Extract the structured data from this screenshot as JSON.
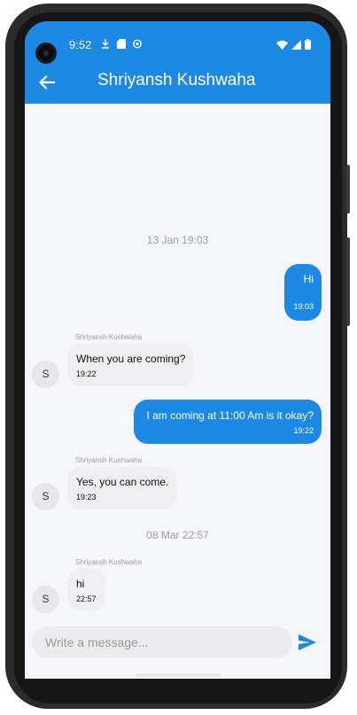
{
  "status_bar": {
    "time": "9:52"
  },
  "header": {
    "title": "Shriyansh Kushwaha"
  },
  "messages": [
    {
      "kind": "date",
      "text": "13 Jan 19:03"
    },
    {
      "kind": "out",
      "text": "Hi",
      "time": "19:03"
    },
    {
      "kind": "in",
      "sender": "Shriyansh Kushwaha",
      "avatar": "S",
      "text": "When you are coming?",
      "time": "19:22"
    },
    {
      "kind": "out",
      "text": "I am coming at 11:00 Am is it okay?",
      "time": "19:22"
    },
    {
      "kind": "in",
      "sender": "Shriyansh Kushwaha",
      "avatar": "S",
      "text": "Yes, you can come.",
      "time": "19:23"
    },
    {
      "kind": "date",
      "text": "08 Mar 22:57"
    },
    {
      "kind": "in",
      "sender": "Shriyansh Kushwaha",
      "avatar": "S",
      "text": "hi",
      "time": "22:57"
    }
  ],
  "composer": {
    "placeholder": "Write a message..."
  },
  "colors": {
    "accent": "#1e88e5",
    "incoming_bubble": "#efeff1",
    "background": "#f5f6fb"
  },
  "icons": {
    "back": "arrow-left-icon",
    "send": "send-icon"
  }
}
